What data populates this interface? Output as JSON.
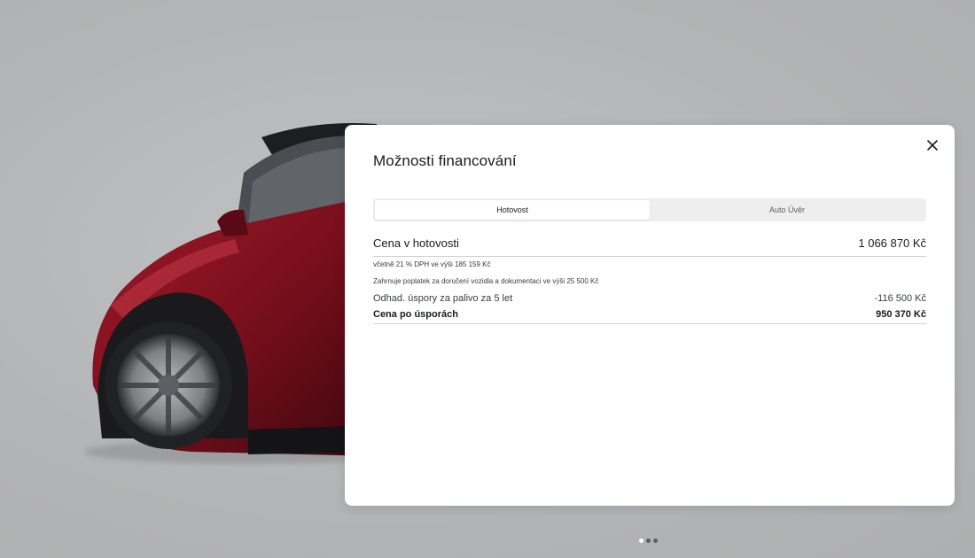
{
  "modal": {
    "title": "Možnosti financování",
    "tabs": [
      {
        "label": "Hotovost",
        "active": true
      },
      {
        "label": "Auto Úvěr",
        "active": false
      }
    ],
    "cash_price": {
      "label": "Cena v hotovosti",
      "amount": "1 066 870 Kč"
    },
    "notes": [
      "včetně 21 % DPH ve výši 185 159 Kč",
      "Zahrnuje poplatek za doručení vozidla a dokumentaci ve výši 25 500 Kč"
    ],
    "fuel_savings": {
      "label": "Odhad. úspory za palivo za 5 let",
      "amount": "-116 500 Kč"
    },
    "price_after_savings": {
      "label": "Cena po úsporách",
      "amount": "950 370 Kč"
    }
  },
  "carousel": {
    "slides": 3,
    "active_index": 0
  },
  "colors": {
    "background": "#b5b6b7",
    "car_red": "#7a0f1c",
    "text_primary": "#171a20",
    "text_secondary": "#5c5e62"
  }
}
